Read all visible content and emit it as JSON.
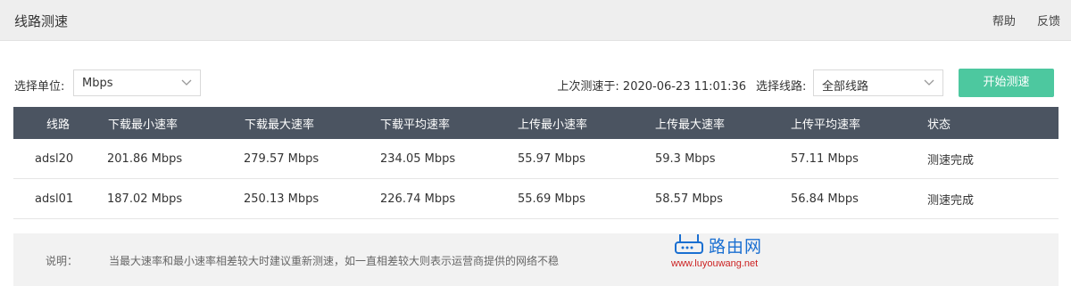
{
  "header": {
    "title": "线路测速",
    "links": [
      "帮助",
      "反馈"
    ]
  },
  "controls": {
    "unit_label": "选择单位:",
    "unit_value": "Mbps",
    "last_test_label": "上次测速于:",
    "last_test_time": "2020-06-23 11:01:36",
    "line_label": "选择线路:",
    "line_value": "全部线路",
    "start_button": "开始测速"
  },
  "table": {
    "columns": [
      "线路",
      "下载最小速率",
      "下载最大速率",
      "下载平均速率",
      "上传最小速率",
      "上传最大速率",
      "上传平均速率",
      "状态"
    ],
    "rows": [
      [
        "adsl20",
        "201.86 Mbps",
        "279.57 Mbps",
        "234.05 Mbps",
        "55.97 Mbps",
        "59.3 Mbps",
        "57.11 Mbps",
        "测速完成"
      ],
      [
        "adsl01",
        "187.02 Mbps",
        "250.13 Mbps",
        "226.74 Mbps",
        "55.69 Mbps",
        "58.57 Mbps",
        "56.84 Mbps",
        "测速完成"
      ]
    ]
  },
  "note": {
    "label": "说明：",
    "text": "当最大速率和最小速率相差较大时建议重新测速，如一直相差较大则表示运营商提供的网络不稳"
  },
  "watermark": {
    "name": "路由网",
    "url": "www.luyouwang.net"
  },
  "colors": {
    "header_bg": "#4b5461",
    "accent": "#4dc89f",
    "topbar_bg": "#eeeeee"
  }
}
